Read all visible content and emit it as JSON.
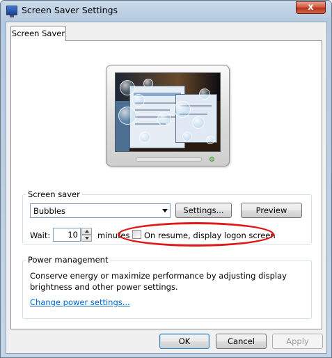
{
  "window": {
    "title": "Screen Saver Settings",
    "close_glyph": "x"
  },
  "tab": {
    "label": "Screen Saver"
  },
  "screen_saver": {
    "group_label": "Screen saver",
    "selected": "Bubbles",
    "settings_button": "Settings...",
    "preview_button": "Preview",
    "wait_label": "Wait:",
    "wait_value": "10",
    "minutes_label": "minutes",
    "resume_label": "On resume, display logon screen",
    "resume_checked": false
  },
  "power": {
    "group_label": "Power management",
    "description": "Conserve energy or maximize performance by adjusting display brightness and other power settings.",
    "link": "Change power settings..."
  },
  "footer": {
    "ok": "OK",
    "cancel": "Cancel",
    "apply": "Apply"
  },
  "colors": {
    "annotation": "#e01818",
    "link": "#0066cc"
  }
}
